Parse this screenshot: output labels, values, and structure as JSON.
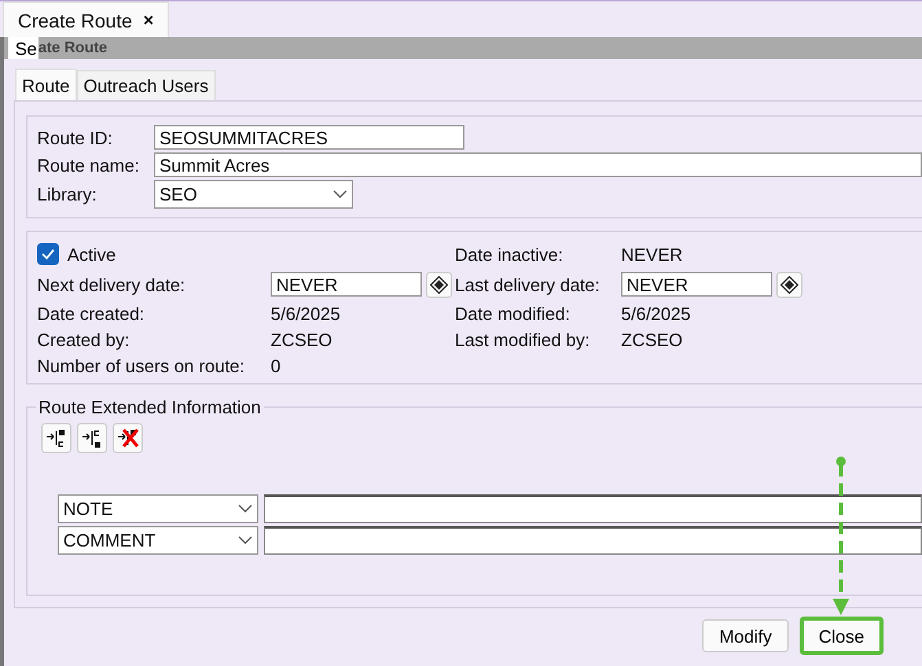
{
  "window_tab": {
    "label": "Create Route",
    "close": "×"
  },
  "title_bar": {
    "overlap": "Se",
    "title": "ate Route"
  },
  "tabs": [
    {
      "label": "Route",
      "selected": true
    },
    {
      "label": "Outreach Users",
      "selected": false
    }
  ],
  "identity": [
    {
      "label": "Route ID:",
      "value": "SEOSUMMITACRES",
      "kind": "short"
    },
    {
      "label": "Route name:",
      "value": "Summit Acres",
      "kind": "wide"
    },
    {
      "label": "Library:",
      "value": "SEO",
      "kind": "select"
    }
  ],
  "active": {
    "label": "Active",
    "checked": true
  },
  "details": [
    {
      "label": "Date inactive:",
      "value": "NEVER",
      "kind": "text"
    },
    {
      "label": "Next delivery date:",
      "value": "NEVER",
      "kind": "date"
    },
    {
      "label": "Last delivery date:",
      "value": "NEVER",
      "kind": "date"
    },
    {
      "label": "Date created:",
      "value": "5/6/2025",
      "kind": "text"
    },
    {
      "label": "Date modified:",
      "value": "5/6/2025",
      "kind": "text"
    },
    {
      "label": "Created by:",
      "value": "ZCSEO",
      "kind": "text"
    },
    {
      "label": "Last modified by:",
      "value": "ZCSEO",
      "kind": "text"
    },
    {
      "label": "Number of users on route:",
      "value": "0",
      "kind": "text"
    }
  ],
  "extended": {
    "legend": "Route Extended Information",
    "rows": [
      {
        "type": "NOTE"
      },
      {
        "type": "COMMENT"
      }
    ]
  },
  "buttons": [
    {
      "label": "Modify",
      "highlighted": false
    },
    {
      "label": "Close",
      "highlighted": true
    }
  ]
}
